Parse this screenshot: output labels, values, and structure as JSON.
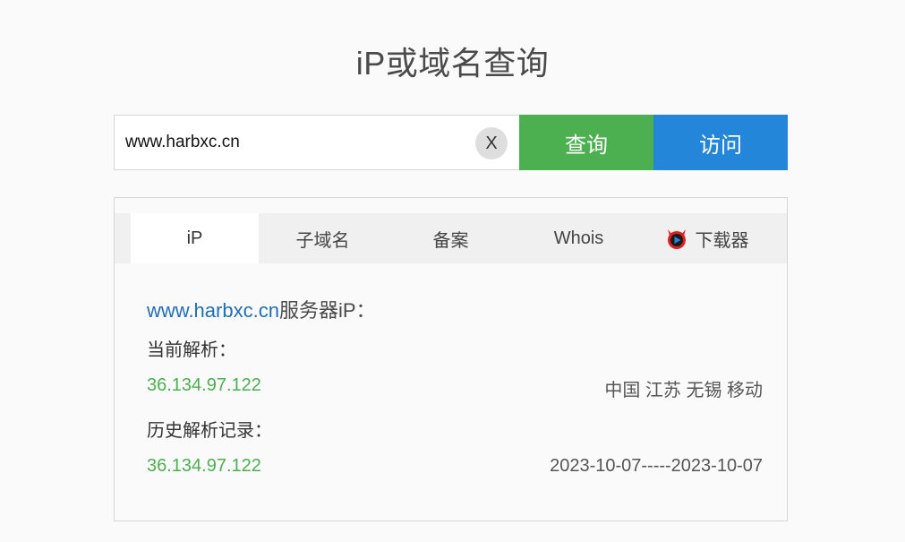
{
  "page": {
    "title": "iP或域名查询"
  },
  "search": {
    "value": "www.harbxc.cn",
    "clear_label": "X",
    "query_label": "查询",
    "visit_label": "访问"
  },
  "tabs": [
    {
      "label": "iP",
      "active": true
    },
    {
      "label": "子域名",
      "active": false
    },
    {
      "label": "备案",
      "active": false
    },
    {
      "label": "Whois",
      "active": false
    },
    {
      "label": "下载器",
      "active": false,
      "icon": "devil-play-icon"
    }
  ],
  "result": {
    "domain": "www.harbxc.cn",
    "heading_suffix": "服务器iP：",
    "current_label": "当前解析：",
    "current": {
      "ip": "36.134.97.122",
      "location": "中国 江苏 无锡 移动"
    },
    "history_label": "历史解析记录：",
    "history": [
      {
        "ip": "36.134.97.122",
        "range": "2023-10-07-----2023-10-07"
      }
    ]
  },
  "colors": {
    "query_button": "#4caf50",
    "visit_button": "#2386d9",
    "ip_text": "#4caf50",
    "domain_link": "#1f6fb8"
  }
}
